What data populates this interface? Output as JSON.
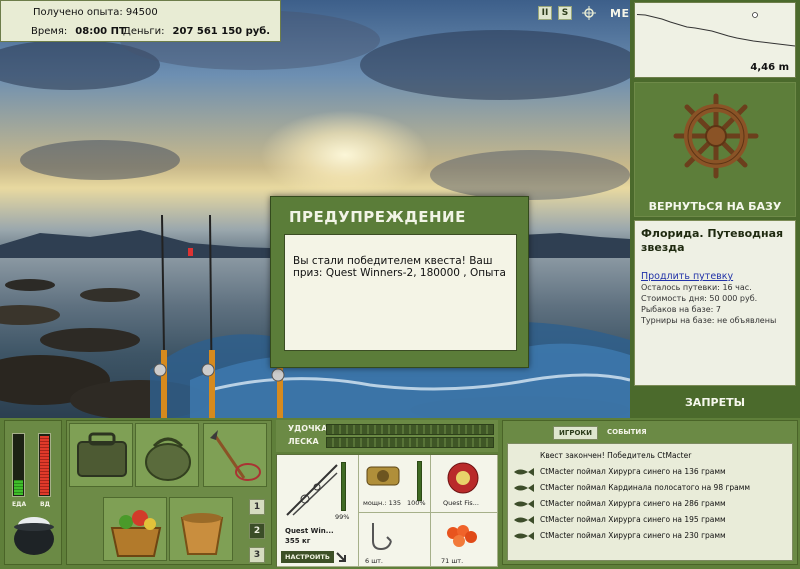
{
  "info": {
    "experience_label": "Получено опыта:",
    "experience_value": "94500",
    "time_label": "Время:",
    "time_value": "08:00 ПТ",
    "money_label": "Деньги:",
    "money_value": "207 561 150 руб."
  },
  "top_icons": {
    "pause": "II",
    "sound": "S",
    "menu": "МЕНЮ"
  },
  "depth": {
    "value": "4,46 m",
    "profile": [
      0.15,
      0.16,
      0.2,
      0.24,
      0.3,
      0.35,
      0.4,
      0.42,
      0.45,
      0.48,
      0.53,
      0.58,
      0.62,
      0.65,
      0.68,
      0.7,
      0.72,
      0.74,
      0.76,
      0.78
    ]
  },
  "base": {
    "back_button": "ВЕРНУТЬСЯ НА БАЗУ",
    "title": "Флорида. Путеводная звезда",
    "extend_link": "Продлить путевку",
    "remaining": "Осталось путевки: 16 час.",
    "day_cost": "Стоимость дня: 50 000 руб.",
    "fishers": "Рыбаков на базе: 7",
    "tournaments": "Турниры на базе: не объявлены",
    "bans_button": "ЗАПРЕТЫ"
  },
  "warning": {
    "title": "ПРЕДУПРЕЖДЕНИЕ",
    "message": "Вы стали победителем квеста! Ваш приз: Quest Winners-2, 180000 , Опыта"
  },
  "meters": {
    "food_label": "ЕДА",
    "sleep_label": "ВД",
    "food_level": 0.25,
    "sleep_level": 0.95
  },
  "inventory": {
    "pages": [
      "1",
      "2",
      "3"
    ],
    "selected_page": 1
  },
  "tackle": {
    "rod_label": "УДОЧКА",
    "line_label": "ЛЕСКА",
    "rod_name": "Quest Win...",
    "rod_weight": "355 кг",
    "rod_percent": "99%",
    "reel_caption": "мощн.: 135",
    "reel_percent": "100%",
    "line_caption": "Quest Fis...",
    "hook_caption": "6 шт.",
    "bait_caption": "71 шт.",
    "setup_button": "НАСТРОИТЬ",
    "rod_level": 0.99,
    "reel_level": 1.0
  },
  "events": {
    "tabs": [
      "ИГРОКИ",
      "СОБЫТИЯ"
    ],
    "selected_tab": 0,
    "rows": [
      "Квест закончен! Победитель CtMacter",
      "CtMacter поймал Хирурга синего на 136 грамм",
      "CtMacter поймал Кардинала полосатого на 98 грамм",
      "CtMacter поймал Хирурга синего на 286 грамм",
      "CtMacter поймал Хирурга синего на 195 грамм",
      "CtMacter поймал Хирурга синего на 230 грамм"
    ]
  }
}
